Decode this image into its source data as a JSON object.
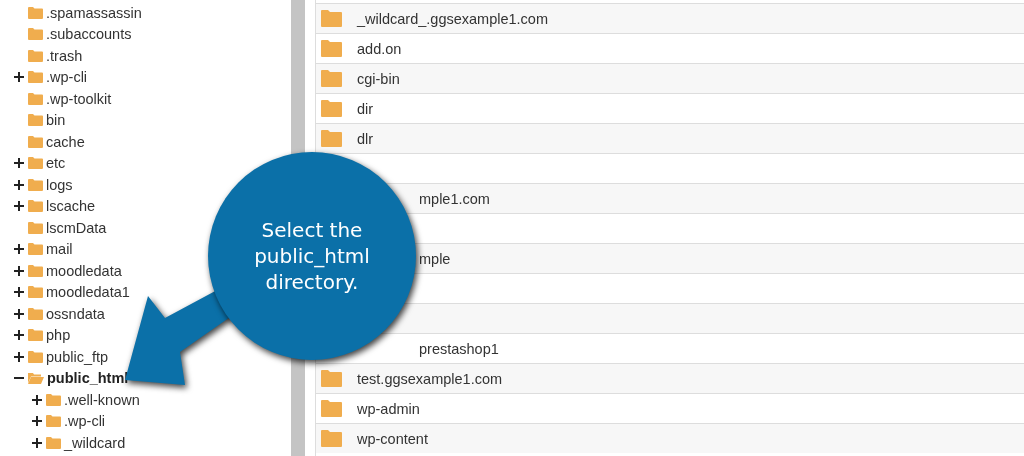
{
  "tree": [
    {
      "name": ".spamassassin",
      "selected": false
    },
    {
      "name": ".subaccounts",
      "selected": false
    },
    {
      "name": ".trash",
      "selected": false
    },
    {
      "name": ".wp-cli",
      "expanded": false,
      "selected": false
    },
    {
      "name": ".wp-toolkit",
      "selected": false
    },
    {
      "name": "bin",
      "selected": false
    },
    {
      "name": "cache",
      "selected": false
    },
    {
      "name": "etc",
      "expanded": false,
      "selected": false
    },
    {
      "name": "logs",
      "expanded": false,
      "selected": false
    },
    {
      "name": "lscache",
      "expanded": false,
      "selected": false
    },
    {
      "name": "lscmData",
      "selected": false
    },
    {
      "name": "mail",
      "expanded": false,
      "selected": false
    },
    {
      "name": "moodledata",
      "expanded": false,
      "selected": false
    },
    {
      "name": "moodledata1",
      "expanded": false,
      "selected": false
    },
    {
      "name": "ossndata",
      "expanded": false,
      "selected": false
    },
    {
      "name": "php",
      "expanded": false,
      "selected": false
    },
    {
      "name": "public_ftp",
      "expanded": false,
      "selected": false
    },
    {
      "name": "public_html",
      "expanded": true,
      "selected": true,
      "children": [
        {
          "name": ".well-known",
          "expanded": false,
          "selected": false
        },
        {
          "name": ".wp-cli",
          "expanded": false,
          "selected": false
        },
        {
          "name": "_wildcard",
          "expanded": false,
          "selected": false
        }
      ]
    }
  ],
  "files": [
    {
      "kind": "folder",
      "name": "_wildcard_.ggsexample1.com"
    },
    {
      "kind": "folder",
      "name": "add.on"
    },
    {
      "kind": "folder",
      "name": "cgi-bin"
    },
    {
      "kind": "folder",
      "name": "dir"
    },
    {
      "kind": "folder",
      "name": "dlr"
    },
    {
      "kind": "blank"
    },
    {
      "kind": "cut",
      "name": "mple1.com"
    },
    {
      "kind": "blank"
    },
    {
      "kind": "cut",
      "name": "mple"
    },
    {
      "kind": "blank"
    },
    {
      "kind": "blank"
    },
    {
      "kind": "cut",
      "name": "prestashop1"
    },
    {
      "kind": "folder",
      "name": "test.ggsexample1.com"
    },
    {
      "kind": "folder",
      "name": "wp-admin"
    },
    {
      "kind": "folder",
      "name": "wp-content"
    }
  ],
  "callout": {
    "text": "Select the public_html directory."
  }
}
